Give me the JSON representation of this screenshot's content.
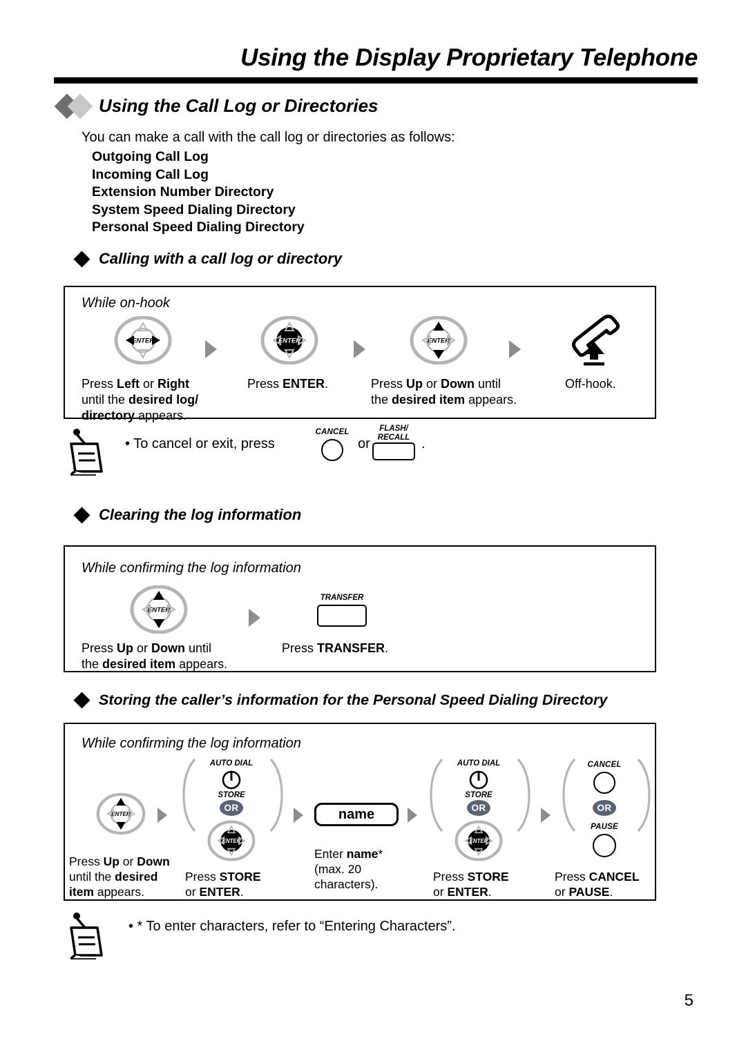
{
  "header": {
    "title": "Using the Display Proprietary Telephone"
  },
  "section": {
    "title": "Using the Call Log or Directories",
    "intro": "You can make a call with the call log or directories as follows:",
    "log_types": [
      "Outgoing Call Log",
      "Incoming Call Log",
      "Extension Number Directory",
      "System Speed Dialing Directory",
      "Personal Speed Dialing Directory"
    ]
  },
  "subsections": {
    "calling": "Calling with a call log or directory",
    "clearing": "Clearing the log information",
    "storing": "Storing the caller’s information for the Personal Speed Dialing Directory"
  },
  "diagram1": {
    "caption": "While on-hook",
    "steps": [
      {
        "key": "navigator-key-left-right",
        "enter_label": "ENTER",
        "text_lines": [
          {
            "plain": "Press ",
            "bold": "Left",
            "mid": " or ",
            "bold2": "Right"
          },
          {
            "plain": "until the ",
            "bold": "desired log/"
          },
          {
            "bold": "directory",
            "plain": " appears."
          }
        ],
        "text_full": "Press Left or Right until the desired log/ directory appears."
      },
      {
        "key": "navigator-key-enter",
        "enter_label": "ENTER",
        "text_full": "Press ENTER."
      },
      {
        "key": "navigator-key-up-down",
        "enter_label": "ENTER",
        "text_full": "Press Up or Down until the desired item appears."
      },
      {
        "key": "handset-offhook",
        "text_full": "Off-hook."
      }
    ]
  },
  "note1": {
    "text_prefix": "• To cancel or exit, press",
    "cancel_label": "CANCEL",
    "or_label": "or",
    "flash_label_line1": "FLASH/",
    "flash_label_line2": "RECALL",
    "text_suffix": "."
  },
  "diagram2": {
    "caption": "While confirming the log information",
    "steps": [
      {
        "key": "navigator-key-up-down",
        "enter_label": "ENTER",
        "text_full": "Press Up or Down until the desired item appears."
      },
      {
        "key": "transfer-button",
        "button_label": "TRANSFER",
        "text_full": "Press TRANSFER."
      }
    ]
  },
  "diagram3": {
    "caption": "While confirming the log information",
    "steps": [
      {
        "key": "navigator-key-up-down",
        "enter_label": "ENTER",
        "text_full": "Press Up or Down until the desired item appears."
      },
      {
        "key": "store-or-enter",
        "auto_dial_label": "AUTO DIAL",
        "store_label": "STORE",
        "or_badge": "OR",
        "enter_label": "ENTER",
        "text_full": "Press STORE or ENTER."
      },
      {
        "key": "name-entry",
        "display_value": "name",
        "text_full": "Enter name* (max. 20 characters)."
      },
      {
        "key": "store-or-enter",
        "auto_dial_label": "AUTO DIAL",
        "store_label": "STORE",
        "or_badge": "OR",
        "enter_label": "ENTER",
        "text_full": "Press STORE or ENTER."
      },
      {
        "key": "cancel-or-pause",
        "cancel_label": "CANCEL",
        "or_badge": "OR",
        "pause_label": "PAUSE",
        "text_full": "Press CANCEL or PAUSE."
      }
    ]
  },
  "note2": {
    "text": "• * To enter characters, refer to “Entering Characters”."
  },
  "footer": {
    "page_number": "5"
  },
  "colors": {
    "diamond_dark": "#6e6e6e",
    "diamond_light": "#c9c9c9",
    "arrow_gray": "#8d8d8d",
    "nav_ring": "#b5b5b5",
    "or_badge": "#5a6474",
    "rule": "#000000"
  }
}
